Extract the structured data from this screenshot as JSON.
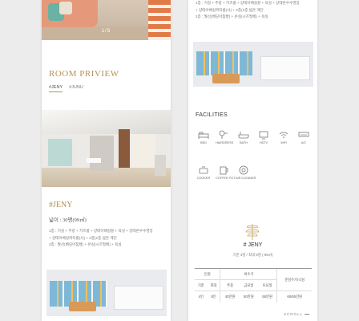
{
  "left_panel": {
    "hero_counter": "1/5",
    "section_title": "ROOM PRIVIEW",
    "tabs": [
      "#JENY",
      "#JUNU"
    ],
    "room_name": "#JENY",
    "room_area": "넓이 : 30평(99㎡)",
    "room_desc": [
      "1층 : 거실 + 주방 + 키즈룸 + 샹테아베실꿀 + 욕실 + 샹테온수수영장",
      "+ 샹테아베실파티룸(사) + 2층(1층 넓은 계단",
      "2층 : 월선(베딩아침빵) + 온실(시즈필베) + 욕실"
    ]
  },
  "right_panel": {
    "room_desc": [
      "1층 : 거실 + 주방 + 키즈룸 + 샹테아베실꿀 + 욕실 + 샹테온수수영장",
      "+ 샹테아베실파티룸(사) + 2층(1층 넓은 계단",
      "2층 : 월선(베딩아침빵) + 온실(시즈필베) + 욕실"
    ],
    "facilities_title": "FACILITIES",
    "facilities": [
      {
        "label": "BED",
        "icon": "bed-icon"
      },
      {
        "label": "HAIRDRESS",
        "icon": "hairdryer-icon"
      },
      {
        "label": "BATH",
        "icon": "bathtub-icon"
      },
      {
        "label": "HDTV",
        "icon": "tv-icon"
      },
      {
        "label": "WiFi",
        "icon": "wifi-icon"
      },
      {
        "label": "A/C",
        "icon": "aircon-icon"
      },
      {
        "label": "COOKER",
        "icon": "cooker-icon"
      },
      {
        "label": "COFFEE POT",
        "icon": "coffeepot-icon"
      },
      {
        "label": "AIR CLEANER",
        "icon": "aircleaner-icon"
      }
    ],
    "room_name": "# JENY",
    "room_meta": "기준 4명 / 최대 8명 ( 99㎡)",
    "price_table": {
      "col_people": "인원",
      "col_season": "비수기",
      "col_peak": "준성수기/극성",
      "sub": [
        "기준",
        "최대",
        "주중",
        "금요일",
        "토요일"
      ],
      "row": [
        "4인",
        "8인",
        "40만원",
        "50만원",
        "55만원",
        "60/65만원"
      ]
    },
    "scroll_label": "SCROLL"
  },
  "accent_color": "#b49358"
}
